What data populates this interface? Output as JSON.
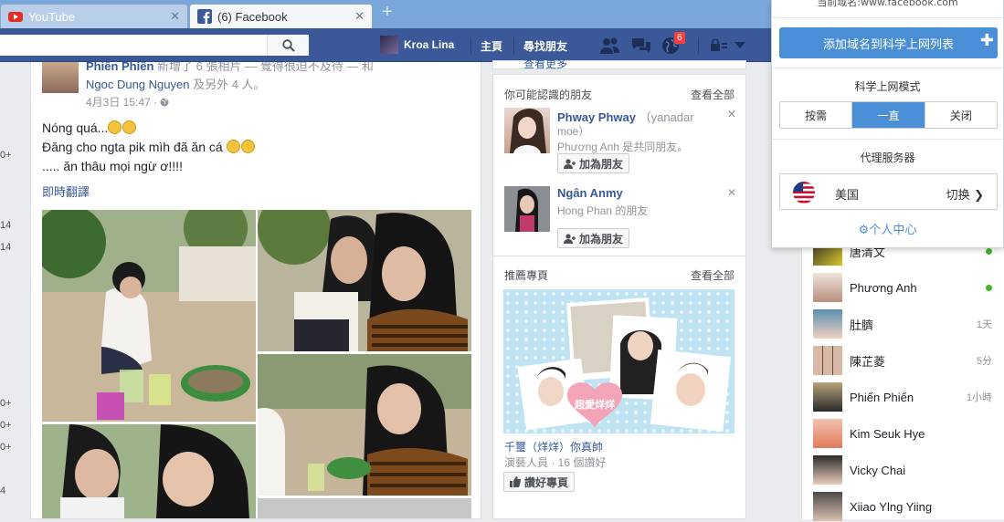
{
  "browser": {
    "tabs": [
      {
        "title": "YouTube",
        "active": false
      },
      {
        "title": "(6) Facebook",
        "active": true
      }
    ],
    "new_tab_symbol": "+"
  },
  "fb_header": {
    "profile_name": "Kroa Lina",
    "home": "主頁",
    "find_friends": "尋找朋友",
    "notification_count": "6"
  },
  "left_numbers": [
    "0+",
    "14",
    "14",
    "0+",
    "0+",
    "0+",
    "4"
  ],
  "post": {
    "author_cut": "Phiến Phiến",
    "author_cut_rest": "新增了 6 張相片 — 覺得很迫不及待 — 和",
    "tagged": "Ngoc Dung Nguyen",
    "tagged_rest": "及另外 4 人。",
    "time": "4月3日 15:47 ·",
    "lines": [
      "Nóng quá...",
      "Đăng cho ngta pik mìh đã ăn cá",
      "..... ăn thâu mọi ngừ ơ!!!!"
    ],
    "translate": "即時翻譯"
  },
  "right": {
    "top_cut": "查看更多",
    "pymk": {
      "title": "你可能認識的朋友",
      "see_all": "查看全部",
      "people": [
        {
          "name": "Phway Phway",
          "name_rest": "（yanadar",
          "line2": "moe）",
          "mutual": "Phương Anh 是共同朋友。",
          "button": "加為朋友"
        },
        {
          "name": "Ngân Anmy",
          "mutual": "Hong Phan 的朋友",
          "button": "加為朋友"
        }
      ]
    },
    "pages": {
      "title": "推薦專頁",
      "see_all": "查看全部",
      "image_caption": "超愛烊烊",
      "page_name": "千璽（烊烊）你真帥",
      "page_meta": "演藝人員 · 16 個讚好",
      "like_button": "讚好專頁"
    }
  },
  "chat": [
    {
      "name": "唐清文",
      "meta": "",
      "online": true
    },
    {
      "name": "Phương Anh",
      "meta": "",
      "online": true
    },
    {
      "name": "肚臍",
      "meta": "1天",
      "online": false
    },
    {
      "name": "陳芷菱",
      "meta": "5分",
      "online": false
    },
    {
      "name": "Phiến Phiến",
      "meta": "1小時",
      "online": false
    },
    {
      "name": "Kim Seuk Hye",
      "meta": "",
      "online": false
    },
    {
      "name": "Vicky Chai",
      "meta": "",
      "online": false
    },
    {
      "name": "Xiiao Ylng Yiing",
      "meta": "",
      "online": false
    }
  ],
  "popup": {
    "current_domain": "当前域名:www.facebook.com",
    "add_button": "添加域名到科学上网列表",
    "add_plus": "✚",
    "mode_title": "科学上网模式",
    "modes": [
      "按需",
      "一直",
      "关闭"
    ],
    "active_mode": "一直",
    "proxy_title": "代理服务器",
    "country": "美国",
    "switch": "切换",
    "center": "个人中心"
  },
  "colors": {
    "fb_blue": "#3b5998",
    "popup_blue": "#4a8fd6",
    "link": "#365899"
  }
}
